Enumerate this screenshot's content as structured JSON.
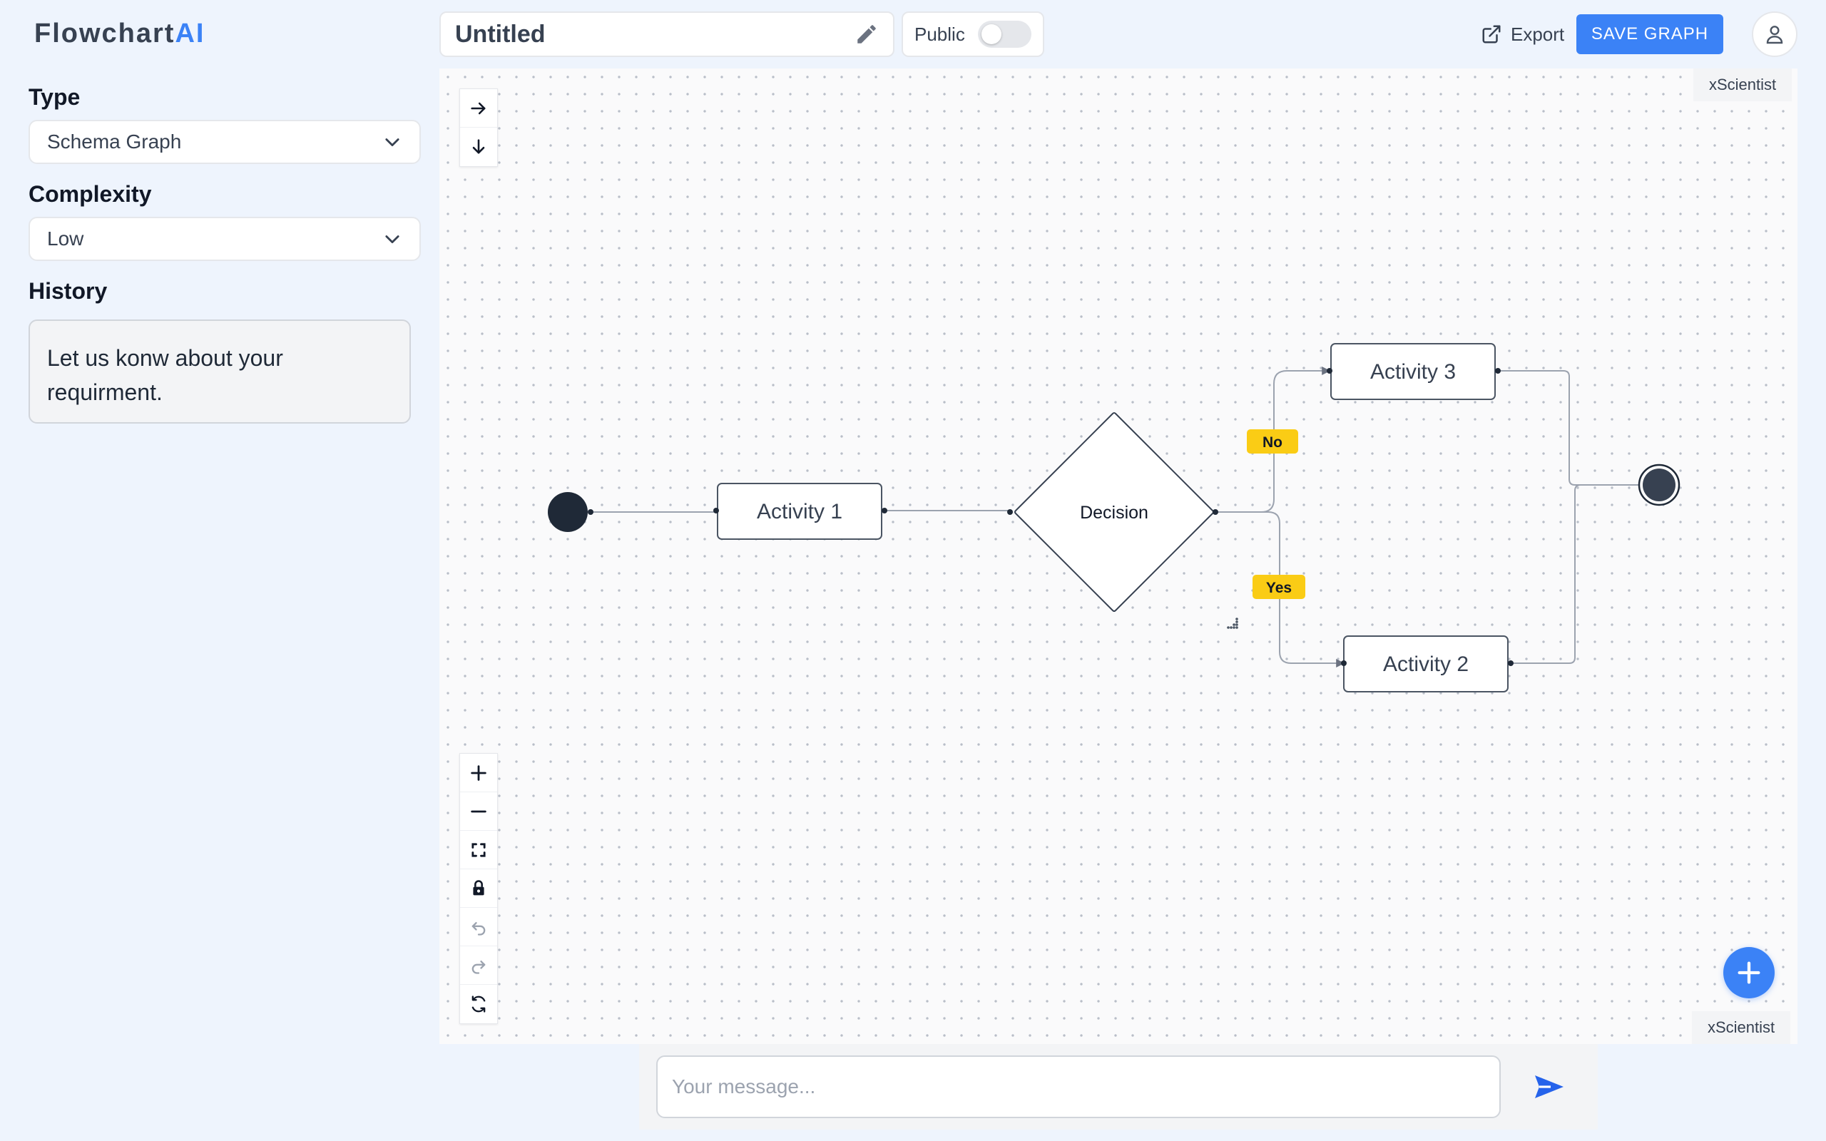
{
  "app": {
    "logo_main": "Flowchart",
    "logo_accent": "AI"
  },
  "sidebar": {
    "type_label": "Type",
    "type_value": "Schema Graph",
    "complexity_label": "Complexity",
    "complexity_value": "Low",
    "history_label": "History",
    "history_text": "Let us konw about your requirment."
  },
  "header": {
    "title": "Untitled",
    "public_label": "Public",
    "public_enabled": false,
    "export_label": "Export",
    "save_label": "SAVE GRAPH"
  },
  "canvas": {
    "watermark_top": "xScientist",
    "watermark_bottom": "xScientist"
  },
  "flow": {
    "nodes": {
      "start": "",
      "activity1": "Activity 1",
      "decision": "Decision",
      "activity2": "Activity 2",
      "activity3": "Activity 3",
      "end": ""
    },
    "edge_labels": {
      "no": "No",
      "yes": "Yes"
    }
  },
  "colors": {
    "accent": "#3b82f6",
    "edge_label_bg": "#facc15",
    "node_border": "#4b5563",
    "start_fill": "#1f2937",
    "end_fill": "#374151"
  },
  "chat": {
    "placeholder": "Your message..."
  },
  "icons": {
    "edit": "pencil-icon",
    "export": "external-link-icon",
    "avatar": "user-icon",
    "send": "send-icon",
    "fab": "plus-icon"
  }
}
